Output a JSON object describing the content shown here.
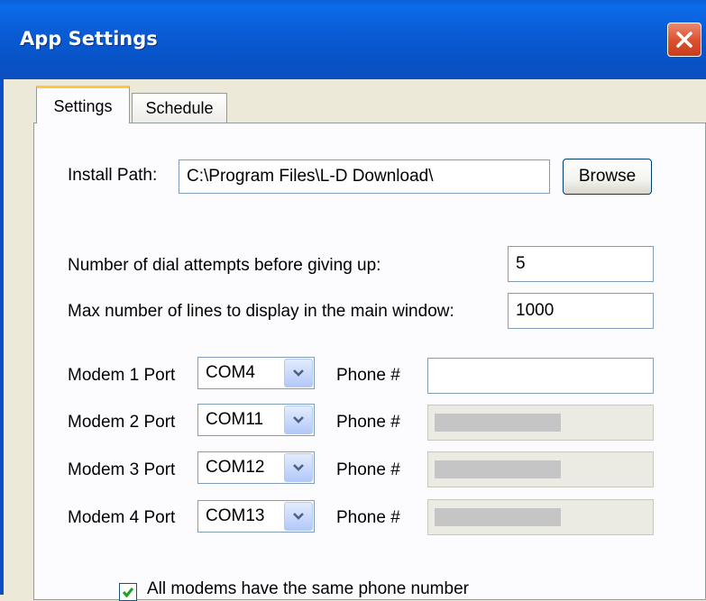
{
  "window": {
    "title": "App Settings"
  },
  "tabs": [
    {
      "label": "Settings",
      "active": true
    },
    {
      "label": "Schedule",
      "active": false
    }
  ],
  "install": {
    "label": "Install Path:",
    "value": "C:\\Program Files\\L-D Download\\",
    "browse_label": "Browse"
  },
  "dial_attempts": {
    "label": "Number of dial attempts before giving up:",
    "value": "5"
  },
  "max_lines": {
    "label": "Max number of lines to display in the main window:",
    "value": "1000"
  },
  "modems": [
    {
      "label": "Modem 1 Port",
      "port": "COM4",
      "phone_label": "Phone #",
      "phone_enabled": true
    },
    {
      "label": "Modem 2 Port",
      "port": "COM11",
      "phone_label": "Phone #",
      "phone_enabled": false
    },
    {
      "label": "Modem 3 Port",
      "port": "COM12",
      "phone_label": "Phone #",
      "phone_enabled": false
    },
    {
      "label": "Modem 4 Port",
      "port": "COM13",
      "phone_label": "Phone #",
      "phone_enabled": false
    }
  ],
  "same_phone": {
    "label": "All modems have the same phone number",
    "checked": true
  },
  "colors": {
    "titlebar": "#0a5cd6",
    "window_bg": "#ece9d8",
    "tab_highlight": "#ffc83c",
    "close": "#dd5331"
  },
  "icons": {
    "close": "close-icon",
    "dropdown": "chevron-down-icon",
    "check": "checkmark-icon"
  }
}
